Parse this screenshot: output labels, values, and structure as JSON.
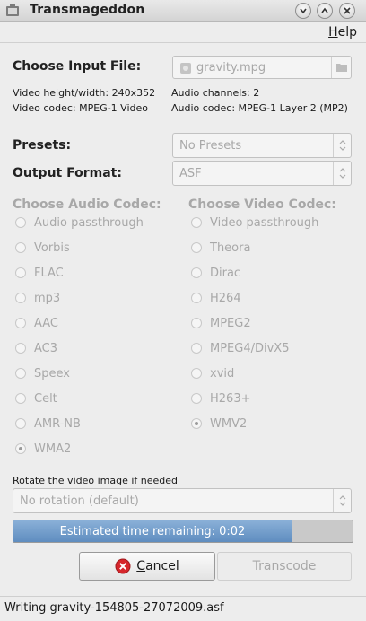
{
  "window": {
    "title": "Transmageddon"
  },
  "menu": {
    "help": "Help"
  },
  "input": {
    "label": "Choose Input File:",
    "file": "gravity.mpg",
    "video_size": "Video height/width: 240x352",
    "video_codec": "Video codec: MPEG-1 Video",
    "audio_channels": "Audio channels: 2",
    "audio_codec": "Audio codec: MPEG-1 Layer 2 (MP2)"
  },
  "presets": {
    "label": "Presets:",
    "value": "No Presets"
  },
  "output_format": {
    "label": "Output Format:",
    "value": "ASF"
  },
  "audio_codecs": {
    "heading": "Choose Audio Codec:",
    "options": [
      "Audio passthrough",
      "Vorbis",
      "FLAC",
      "mp3",
      "AAC",
      "AC3",
      "Speex",
      "Celt",
      "AMR-NB",
      "WMA2"
    ],
    "selected": "WMA2"
  },
  "video_codecs": {
    "heading": "Choose Video Codec:",
    "options": [
      "Video passthrough",
      "Theora",
      "Dirac",
      "H264",
      "MPEG2",
      "MPEG4/DivX5",
      "xvid",
      "H263+",
      "WMV2"
    ],
    "selected": "WMV2"
  },
  "rotation": {
    "label": "Rotate the video image if needed",
    "value": "No rotation (default)"
  },
  "progress": {
    "text": "Estimated time remaining: 0:02",
    "fraction": 0.82
  },
  "buttons": {
    "cancel": "Cancel",
    "transcode": "Transcode"
  },
  "status": "Writing gravity-154805-27072009.asf",
  "colors": {
    "progress_fill": "#6f9ccc",
    "cancel_icon": "#d6262b"
  }
}
